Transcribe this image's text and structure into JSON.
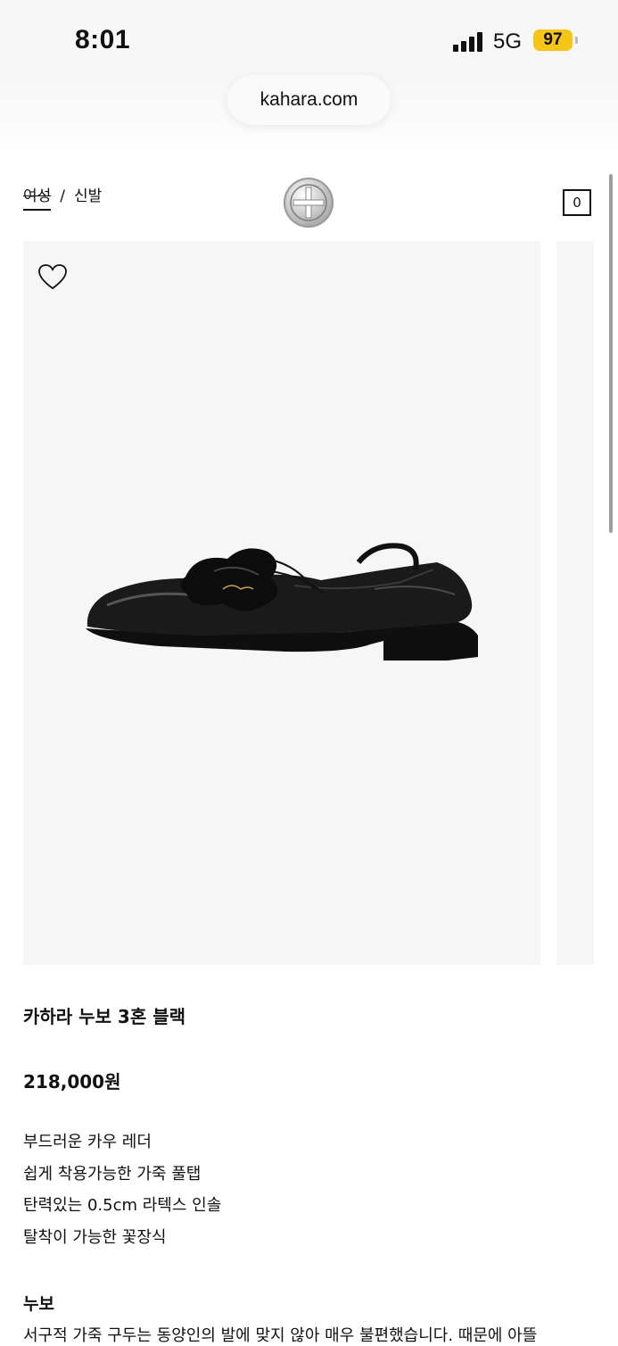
{
  "status_bar": {
    "time": "8:01",
    "network": "5G",
    "battery": "97"
  },
  "browser": {
    "url": "kahara.com"
  },
  "nav": {
    "breadcrumb": [
      {
        "label": "여성"
      },
      {
        "label": "신발"
      }
    ],
    "separator": "/",
    "cart_count": "0"
  },
  "icons": {
    "wishlist": "heart-outline-icon",
    "logo": "kahara-emblem-icon",
    "signal": "signal-bars-icon"
  },
  "colors": {
    "battery": "#f5c518",
    "image_bg": "#f6f6f6",
    "text": "#111111"
  },
  "product": {
    "name": "카하라 누보 3혼 블랙",
    "price": "218,000원",
    "features": [
      "부드러운 카우 레더",
      "쉽게 착용가능한 가죽 풀탭",
      "탄력있는 0.5cm 라텍스 인솔",
      "탈착이 가능한 꽃장식"
    ],
    "section_title": "누보",
    "section_body": "서구적 가죽 구두는 동양인의 발에 맞지 않아 매우 불편했습니다. 때문에 아뜰"
  }
}
